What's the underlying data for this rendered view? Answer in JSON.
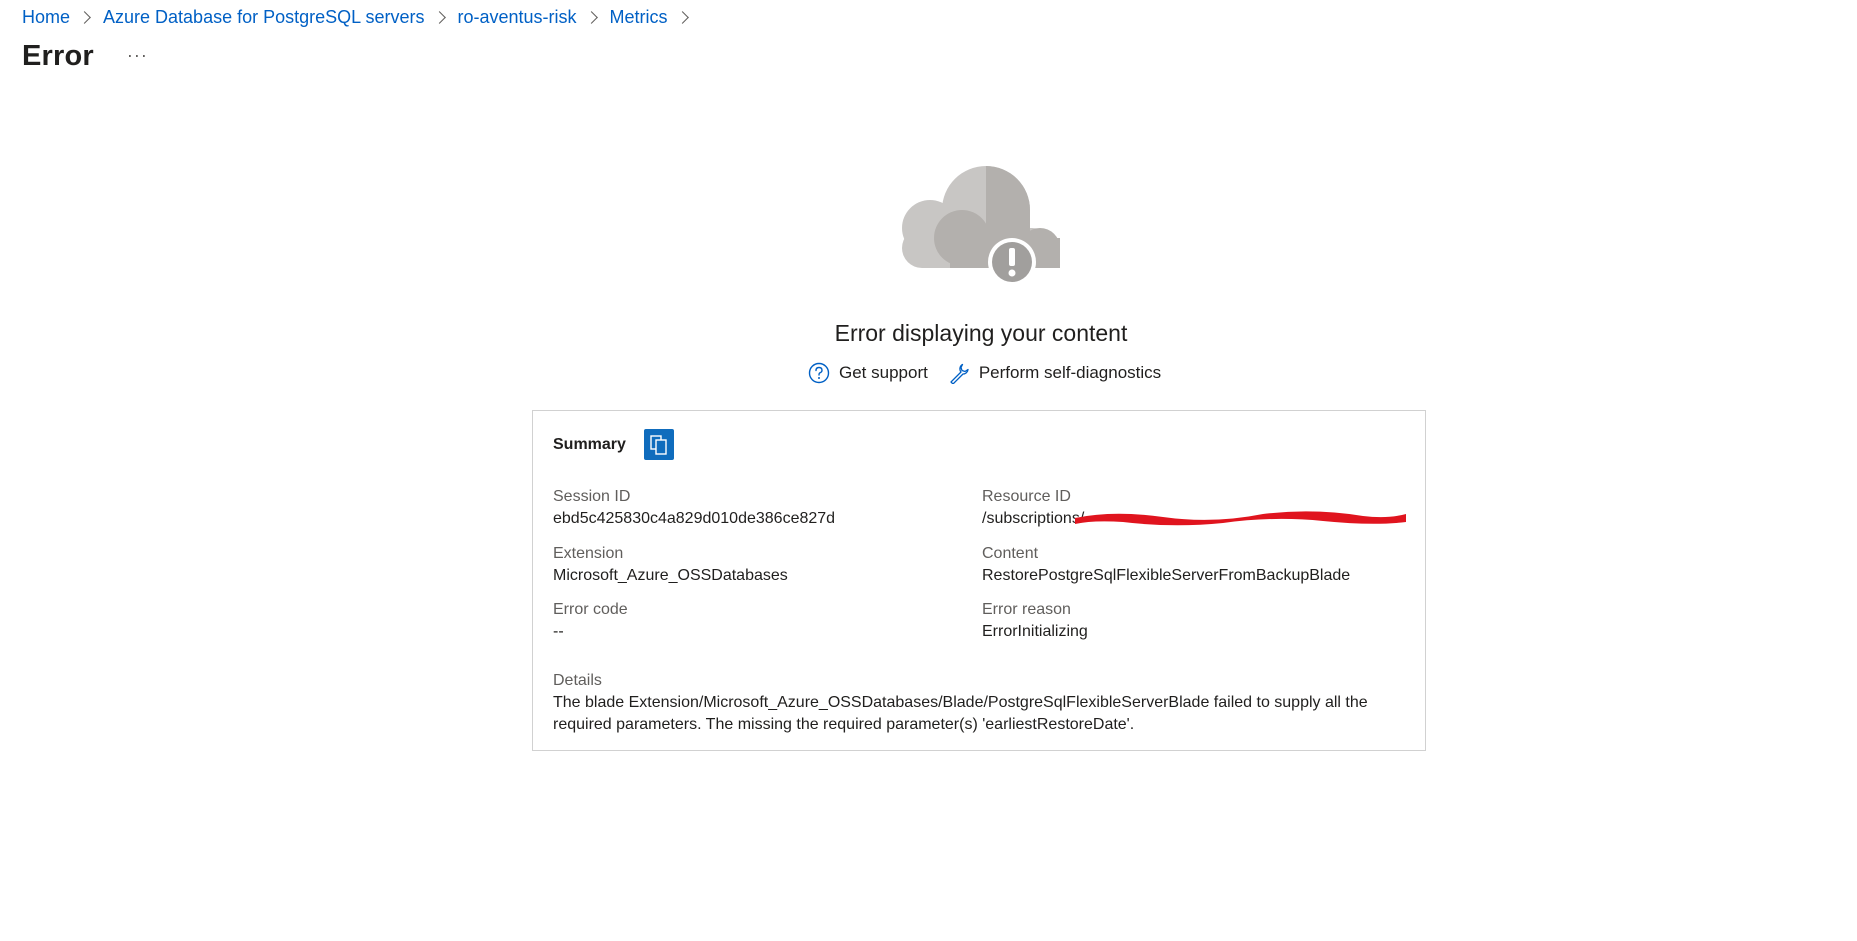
{
  "breadcrumb": {
    "items": [
      "Home",
      "Azure Database for PostgreSQL servers",
      "ro-aventus-risk",
      "Metrics"
    ]
  },
  "page": {
    "title": "Error",
    "more_label": "···"
  },
  "error": {
    "heading": "Error displaying your content",
    "get_support": "Get support",
    "self_diagnostics": "Perform self-diagnostics"
  },
  "summary": {
    "title": "Summary",
    "session_id_label": "Session ID",
    "session_id": "ebd5c425830c4a829d010de386ce827d",
    "resource_id_label": "Resource ID",
    "resource_id": "/subscriptions/",
    "extension_label": "Extension",
    "extension": "Microsoft_Azure_OSSDatabases",
    "content_label": "Content",
    "content": "RestorePostgreSqlFlexibleServerFromBackupBlade",
    "error_code_label": "Error code",
    "error_code": "--",
    "error_reason_label": "Error reason",
    "error_reason": "ErrorInitializing",
    "details_label": "Details",
    "details": "The blade Extension/Microsoft_Azure_OSSDatabases/Blade/PostgreSqlFlexibleServerBlade failed to supply all the required parameters. The missing the required parameter(s) 'earliestRestoreDate'."
  },
  "colors": {
    "link": "#0060c5",
    "copy_button": "#0f6cbd",
    "redaction": "#e0141e"
  },
  "icons": [
    "chevron-right-icon",
    "cloud-error-icon",
    "question-circle-icon",
    "wrench-icon",
    "copy-icon"
  ]
}
